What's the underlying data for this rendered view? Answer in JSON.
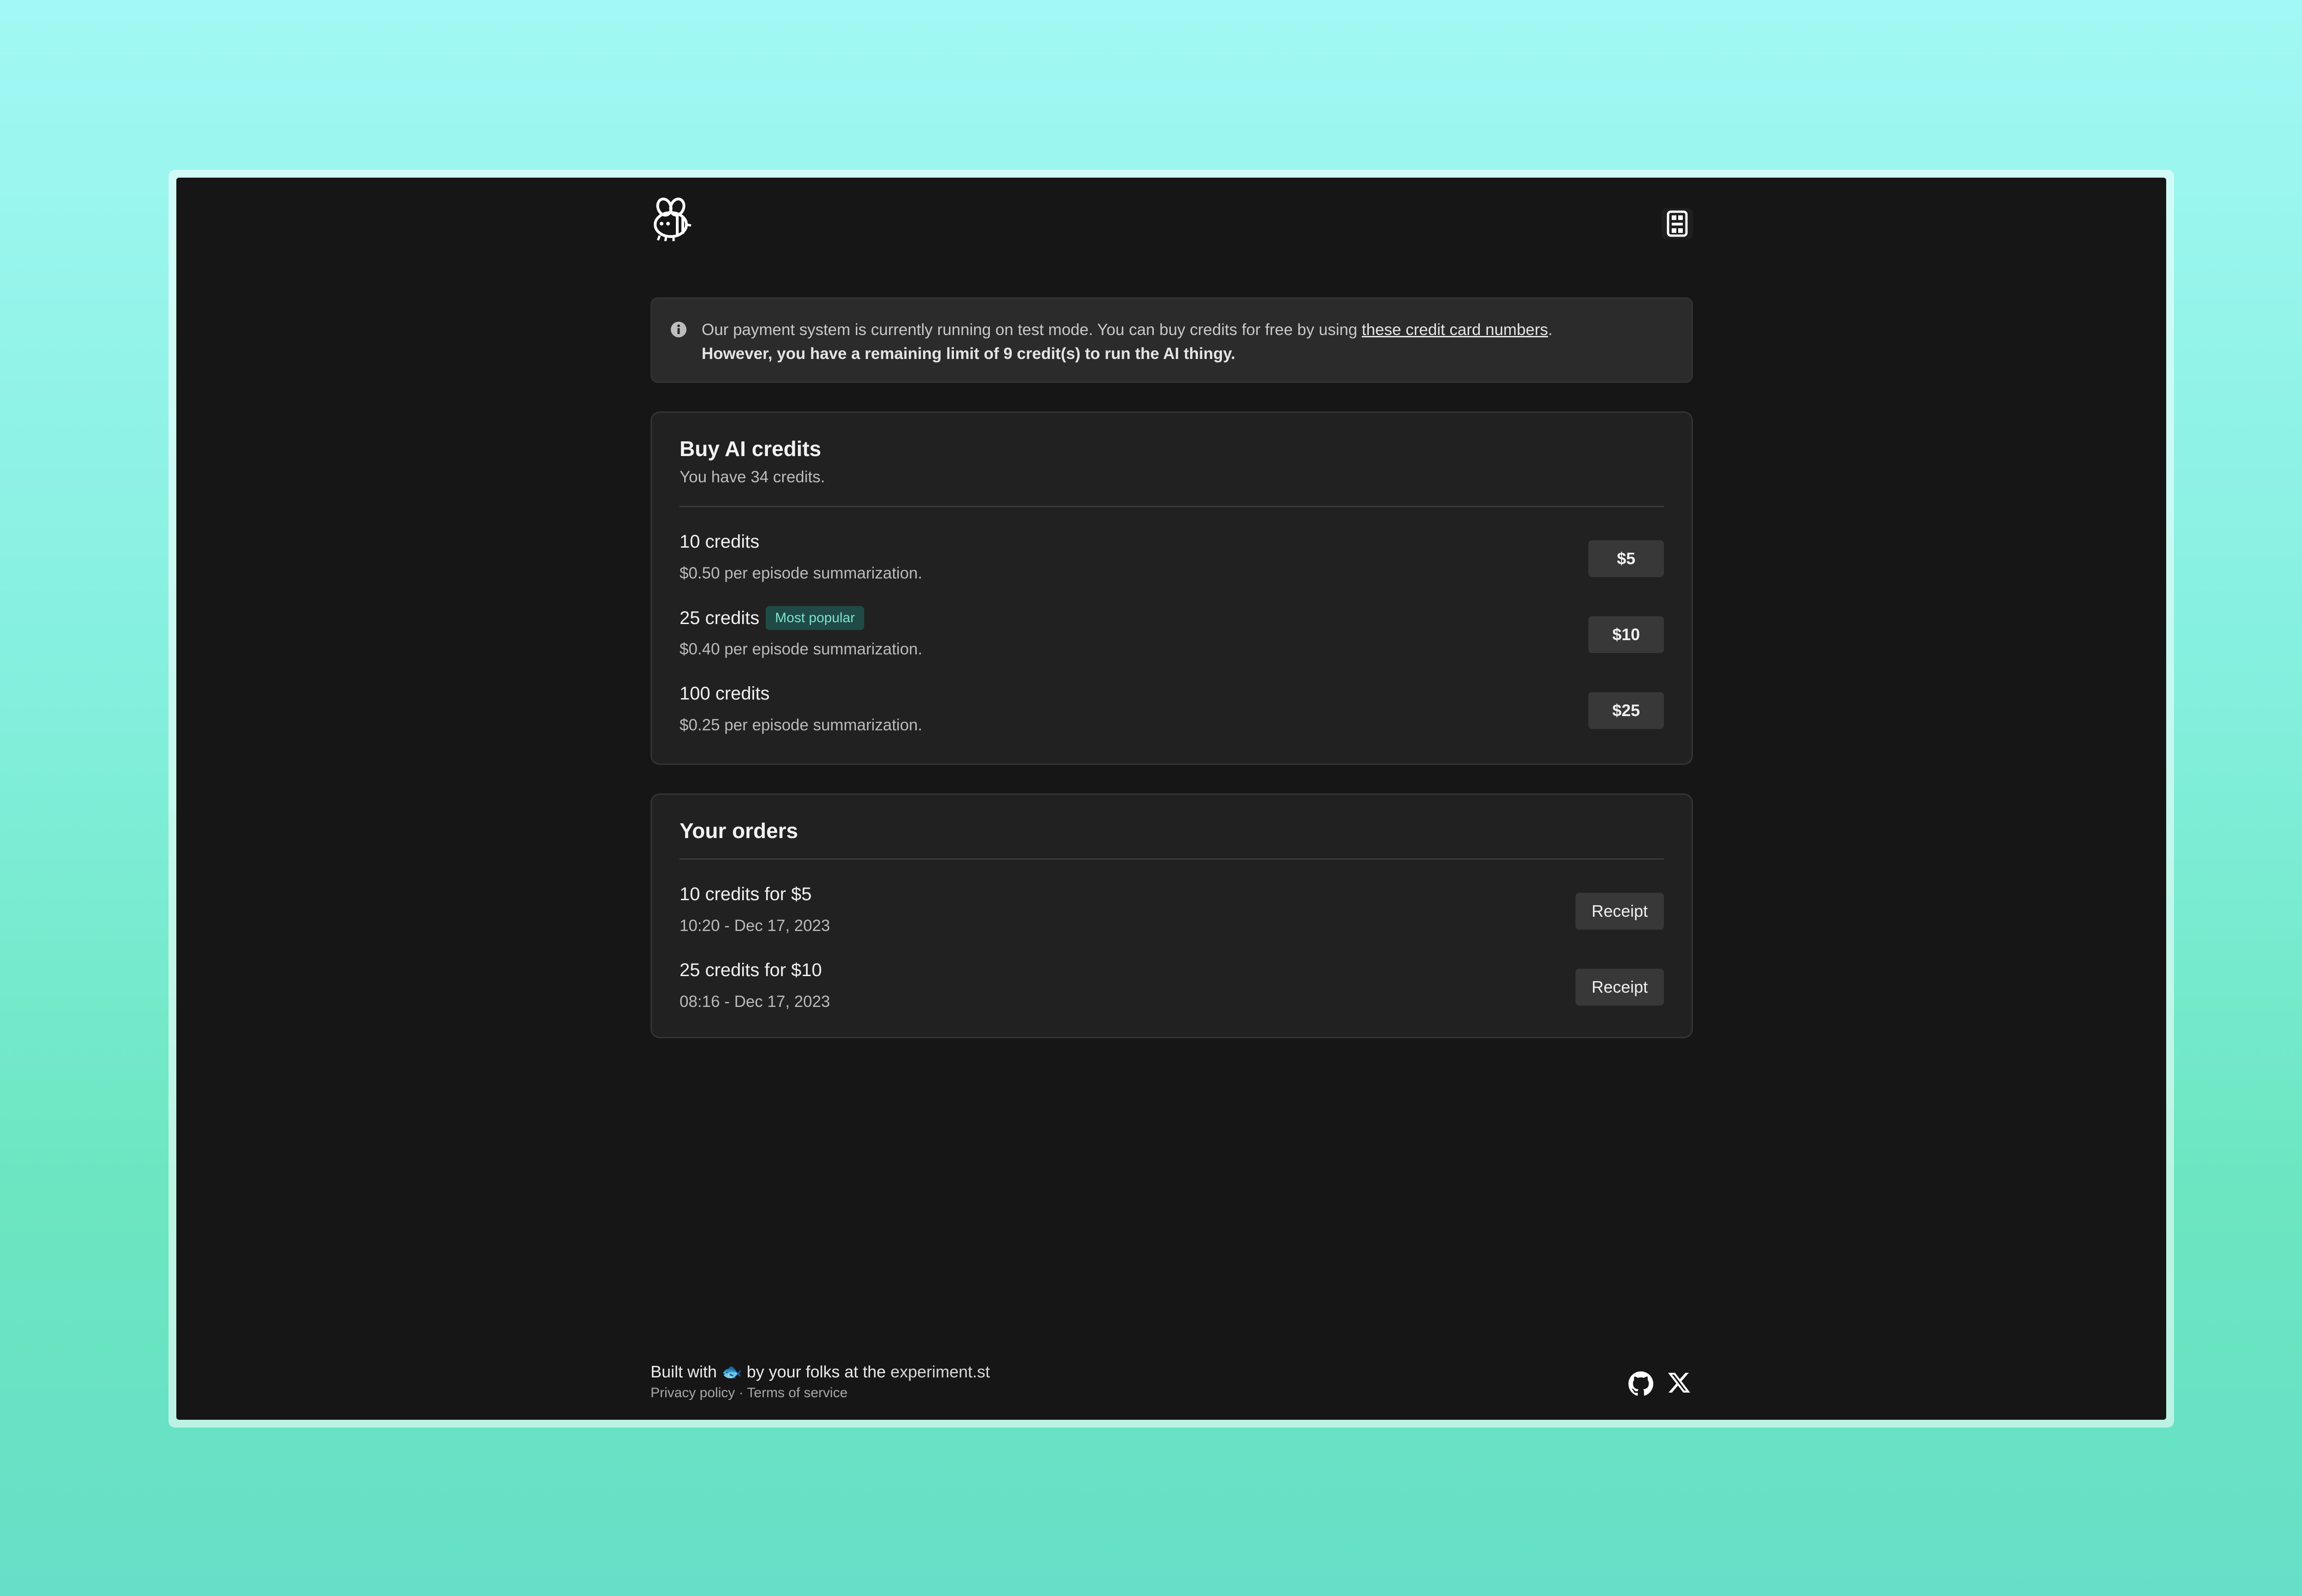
{
  "notice": {
    "text": "Our payment system is currently running on test mode. You can buy credits for free by using ",
    "link": "these credit card numbers",
    "after_link": ".",
    "limit": "However, you have a remaining limit of 9 credit(s) to run the AI thingy."
  },
  "buy": {
    "title": "Buy AI credits",
    "subtitle": "You have 34 credits.",
    "packages": [
      {
        "title": "10 credits",
        "badge": "",
        "rate": "$0.50 per episode summarization.",
        "price": "$5"
      },
      {
        "title": "25 credits",
        "badge": "Most popular",
        "rate": "$0.40 per episode summarization.",
        "price": "$10"
      },
      {
        "title": "100 credits",
        "badge": "",
        "rate": "$0.25 per episode summarization.",
        "price": "$25"
      }
    ]
  },
  "orders": {
    "title": "Your orders",
    "items": [
      {
        "title": "10 credits for $5",
        "date": "10:20 - Dec 17, 2023",
        "button": "Receipt"
      },
      {
        "title": "25 credits for $10",
        "date": "08:16 - Dec 17, 2023",
        "button": "Receipt"
      }
    ]
  },
  "footer": {
    "built_prefix": "Built with 🐟 by your folks at the ",
    "site": "experiment.st",
    "privacy": "Privacy policy",
    "separator": " · ",
    "terms": "Terms of service"
  },
  "icons": {
    "logo": "bee-icon",
    "avatar": "avatar-icon",
    "notice": "info-icon",
    "github": "github-icon",
    "x": "x-icon"
  },
  "colors": {
    "window_bg": "#161616",
    "card_bg": "#212121",
    "badge_bg": "#1f4a45",
    "badge_text": "#7ee2d0"
  }
}
